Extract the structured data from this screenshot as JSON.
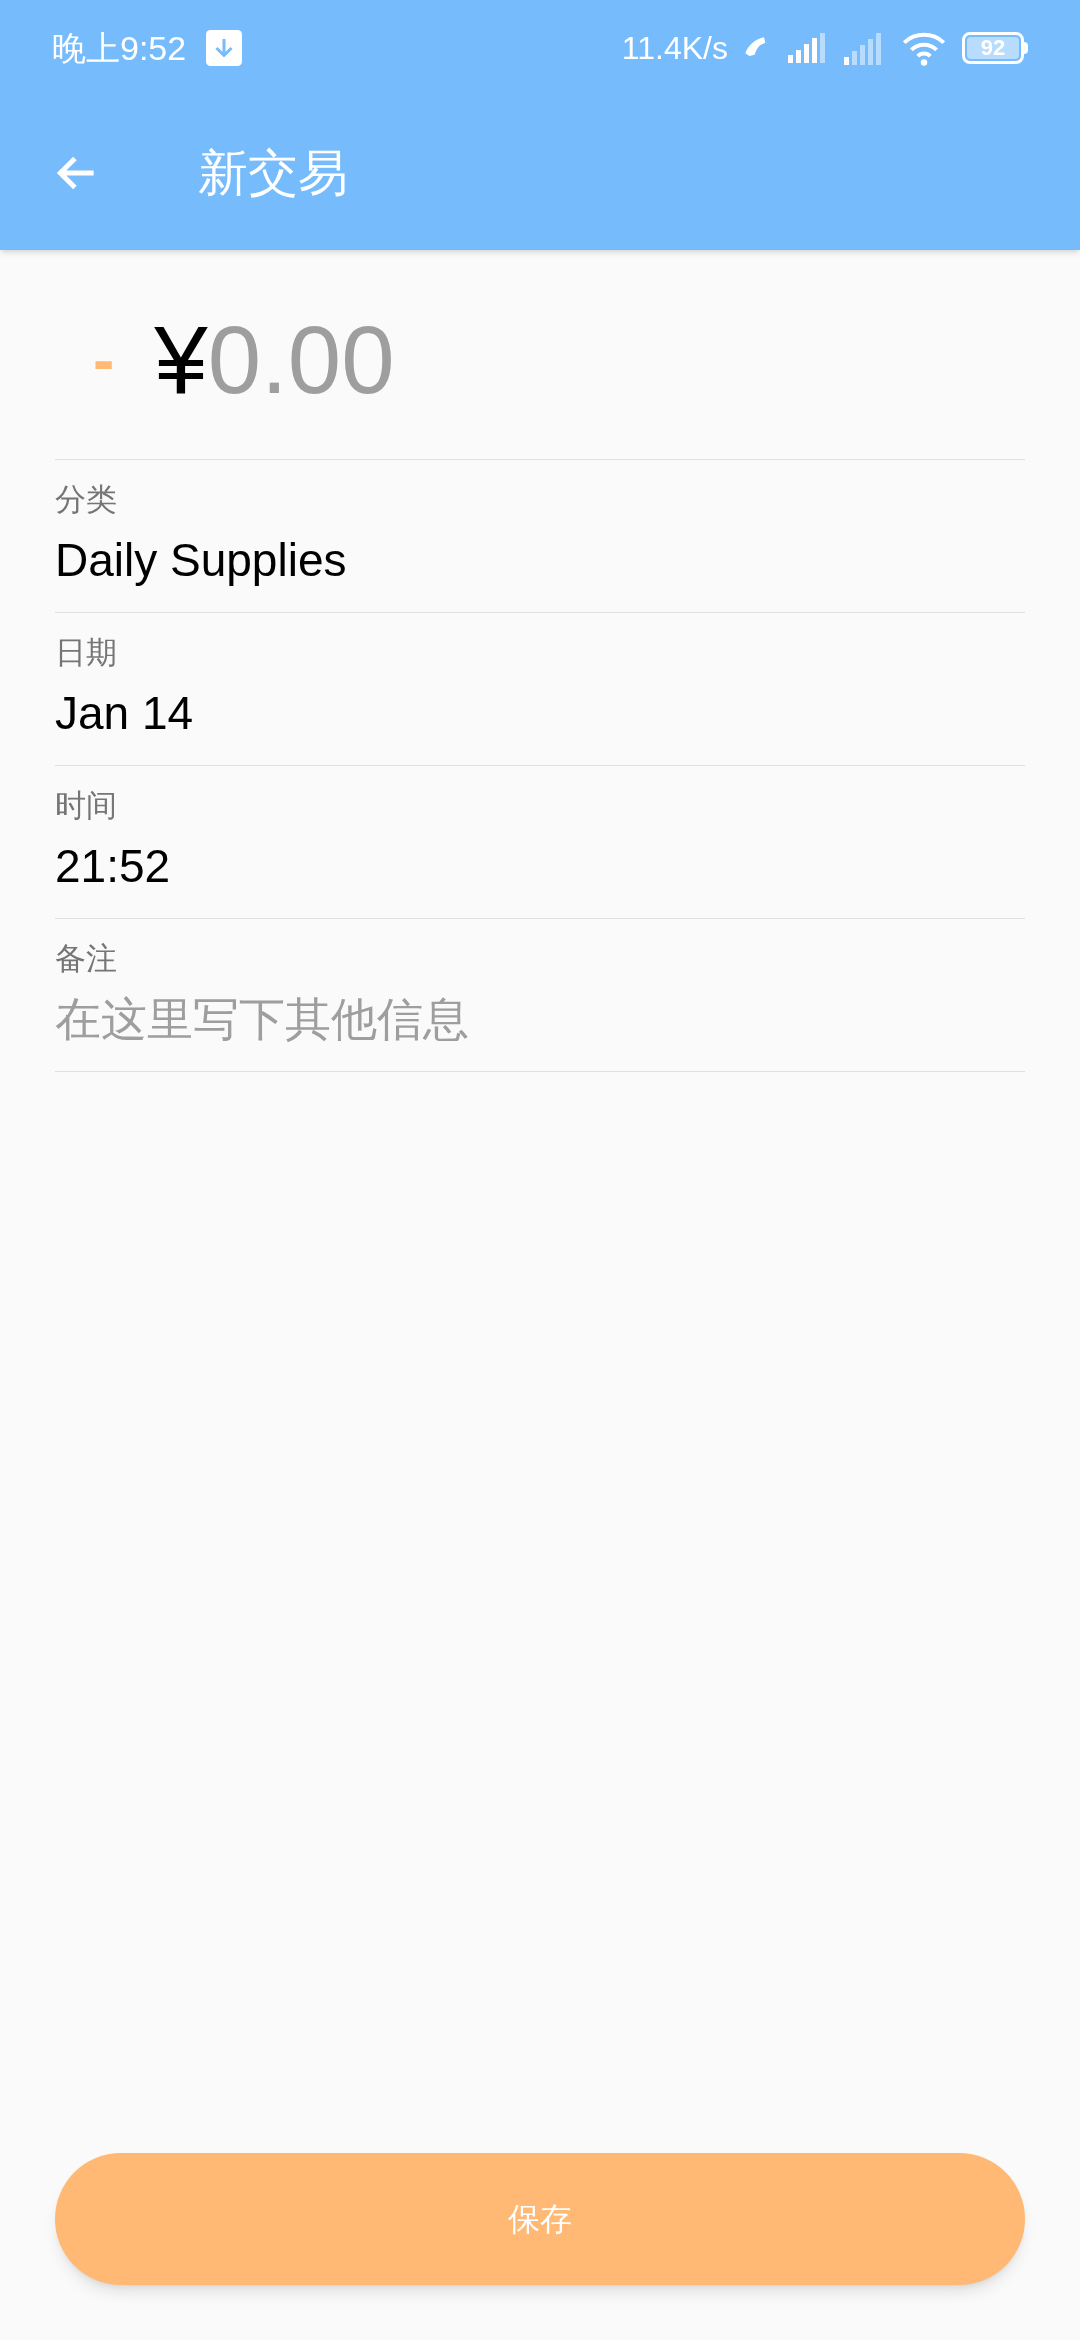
{
  "status_bar": {
    "time": "晚上9:52",
    "speed": "11.4K/s",
    "battery": "92"
  },
  "app_bar": {
    "title": "新交易"
  },
  "amount": {
    "sign": "-",
    "currency": "¥",
    "value": "0.00"
  },
  "fields": [
    {
      "label": "分类",
      "value": "Daily Supplies"
    },
    {
      "label": "日期",
      "value": "Jan 14"
    },
    {
      "label": "时间",
      "value": "21:52"
    },
    {
      "label": "备注",
      "placeholder": "在这里写下其他信息"
    }
  ],
  "save_button": {
    "label": "保存"
  }
}
